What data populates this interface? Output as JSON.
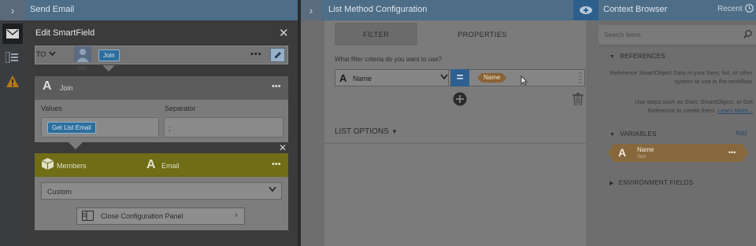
{
  "left": {
    "title": "Send Email",
    "smartfield": {
      "title": "Edit SmartField",
      "close": "✕",
      "to_label": "TO",
      "person_sub": "Join",
      "join_chip": "Join",
      "dots": "•••"
    },
    "join": {
      "letter": "A",
      "label": "Join",
      "values_label": "Values",
      "separator_label": "Separator",
      "values_chip": "Get List  Email",
      "separator_value": ";",
      "dots": "•••"
    },
    "members": {
      "close": "✕",
      "label": "Members",
      "field_letter": "A",
      "field_label": "Email",
      "dots": "•••",
      "select_value": "Custom",
      "close_config_label": "Close Configuration Panel"
    }
  },
  "middle": {
    "title": "List Method Configuration",
    "tabs": [
      "FILTER",
      "PROPERTIES"
    ],
    "filter_question": "What filter criteria do you want to use?",
    "field_letter": "A",
    "field_value": "Name",
    "operator": "=",
    "value_chip": "Name",
    "list_options_label": "LIST OPTIONS"
  },
  "right": {
    "title": "Context Browser",
    "recent": "Recent",
    "search_placeholder": "Search items",
    "references_label": "REFERENCES",
    "references_desc1": "Reference SmartObject Data in your form, list, or other system to use in the workflow.",
    "references_desc2": "Use steps such as Start, SmartObject, or Get Reference to create them.",
    "learn_more": "Learn More...",
    "variables_label": "VARIABLES",
    "add_label": "Add",
    "variable": {
      "letter": "A",
      "name": "Name",
      "type": "Text",
      "dots": "•••"
    },
    "environment_label": "ENVIRONMENT FIELDS"
  }
}
